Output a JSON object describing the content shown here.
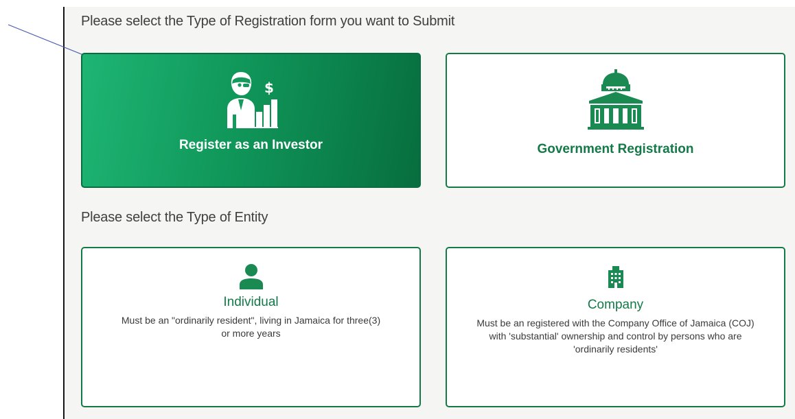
{
  "headings": {
    "registration": "Please select the Type of Registration form you want to Submit",
    "entity": "Please select the Type of Entity"
  },
  "registration_options": {
    "investor": {
      "title": "Register as an Investor",
      "icon": "investor-icon"
    },
    "government": {
      "title": "Government Registration",
      "icon": "government-building-icon"
    }
  },
  "entity_options": {
    "individual": {
      "title": "Individual",
      "description": "Must be an \"ordinarily resident\", living in Jamaica for three(3) or more years",
      "icon": "person-icon"
    },
    "company": {
      "title": "Company",
      "description": "Must be an registered with the Company Office of Jamaica (COJ) with 'substantial' ownership and control by persons who are 'ordinarily residents'",
      "icon": "office-building-icon"
    }
  },
  "colors": {
    "accent_green": "#137a47",
    "selected_gradient_start": "#1eb573",
    "selected_gradient_end": "#076e3e",
    "annotation_arrow": "#4a5bb0"
  }
}
